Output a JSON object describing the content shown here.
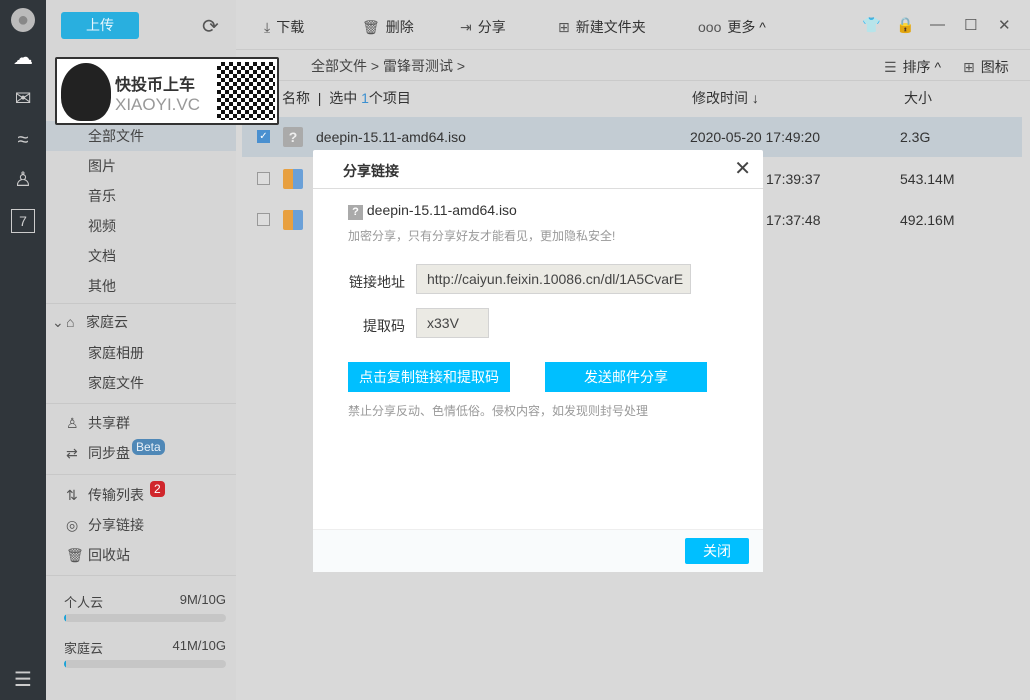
{
  "rail": {
    "icons": [
      "avatar-icon",
      "cloud-icon",
      "mail-icon",
      "fish-icon",
      "contacts-icon",
      "calendar-icon",
      "menu-icon"
    ],
    "calendar_day": "7"
  },
  "sidebar": {
    "upload": "上传",
    "items": [
      {
        "label": "全部文件"
      },
      {
        "label": "图片"
      },
      {
        "label": "音乐"
      },
      {
        "label": "视频"
      },
      {
        "label": "文档"
      },
      {
        "label": "其他"
      }
    ],
    "family": {
      "label": "家庭云",
      "items": [
        "家庭相册",
        "家庭文件"
      ]
    },
    "share_group": "共享群",
    "sync": "同步盘",
    "beta": "Beta",
    "transfer": "传输列表",
    "transfer_count": "2",
    "share_links": "分享链接",
    "recycle": "回收站",
    "quota": [
      {
        "label": "个人云",
        "value": "9M/10G",
        "fraction": 0.001
      },
      {
        "label": "家庭云",
        "value": "41M/10G",
        "fraction": 0.004
      }
    ]
  },
  "toolbar": {
    "download": "下载",
    "delete": "删除",
    "share": "分享",
    "new_folder": "新建文件夹",
    "more": "更多"
  },
  "breadcrumb": {
    "path": "全部文件 > 雷锋哥测试 >",
    "sort": "排序",
    "view": "图标"
  },
  "table": {
    "col_name": "名称",
    "selected_prefix": "选中",
    "selected_count": "1",
    "selected_suffix": "个项目",
    "col_time": "修改时间 ↓",
    "col_size": "大小",
    "rows": [
      {
        "name": "deepin-15.11-amd64.iso",
        "time": "2020-05-20 17:49:20",
        "size": "2.3G",
        "selected": true
      },
      {
        "name": "",
        "time": "17:39:37",
        "size": "543.14M",
        "selected": false
      },
      {
        "name": "",
        "time": "17:37:48",
        "size": "492.16M",
        "selected": false
      }
    ]
  },
  "dialog": {
    "title": "分享链接",
    "file": "deepin-15.11-amd64.iso",
    "hint": "加密分享，只有分享好友才能看见，更加隐私安全!",
    "link_label": "链接地址",
    "link": "http://caiyun.feixin.10086.cn/dl/1A5CvarE",
    "code_label": "提取码",
    "code": "x33V",
    "copy_btn": "点击复制链接和提取码",
    "mail_btn": "发送邮件分享",
    "notice": "禁止分享反动、色情低俗。侵权内容，如发现则封号处理",
    "close": "关闭"
  },
  "watermark": {
    "text1": "快投币上车",
    "text2": "XIAOYI.VC"
  },
  "colors": {
    "accent": "#00bfff",
    "rail": "#30363b",
    "upload": "#29afdf",
    "badge_red": "#d0262c"
  }
}
